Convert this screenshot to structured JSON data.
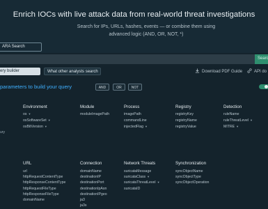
{
  "hero": {
    "title": "Enrich IOCs with live attack data from real-world threat investigations",
    "subtitle": "Search for IPs, URLs, hashes, events — or combine them using advanced logic (AND, OR, NOT, *)",
    "yara_button": "ARA Search"
  },
  "search": {
    "button": "Searc",
    "placeholder": ""
  },
  "tabs": [
    {
      "label": "ery builder",
      "active": true
    },
    {
      "label": "What other analysts search",
      "active": false
    }
  ],
  "links": {
    "pdf_guide": "Download PDF Guide",
    "api": "API do"
  },
  "prompt": "parameters to build your query",
  "operators": [
    "AND",
    "OR",
    "NOT"
  ],
  "toggle_state": "on",
  "stray_text": "ury",
  "columns_top": [
    {
      "header": "Environment",
      "items": [
        {
          "label": "os",
          "dropdown": true
        },
        {
          "label": "osSoftwareSet",
          "dropdown": true
        },
        {
          "label": "osBitVersion",
          "dropdown": true
        }
      ]
    },
    {
      "header": "Module",
      "items": [
        {
          "label": "moduleImagePath",
          "dropdown": false
        }
      ]
    },
    {
      "header": "Process",
      "items": [
        {
          "label": "imagePath",
          "dropdown": false
        },
        {
          "label": "commandLine",
          "dropdown": false
        },
        {
          "label": "injectedFlag",
          "dropdown": true
        }
      ]
    },
    {
      "header": "Registry",
      "items": [
        {
          "label": "registryKey",
          "dropdown": false
        },
        {
          "label": "registryName",
          "dropdown": false
        },
        {
          "label": "registryValue",
          "dropdown": false
        }
      ]
    },
    {
      "header": "Detection",
      "items": [
        {
          "label": "ruleName",
          "dropdown": false
        },
        {
          "label": "ruleThreatLevel",
          "dropdown": true
        },
        {
          "label": "MITRE",
          "dropdown": true
        }
      ]
    }
  ],
  "columns_bottom": [
    {
      "header": "URL",
      "items": [
        {
          "label": "url",
          "dropdown": false
        },
        {
          "label": "httpRequestContentType",
          "dropdown": false
        },
        {
          "label": "httpResponseContentType",
          "dropdown": false
        },
        {
          "label": "httpRequestFileType",
          "dropdown": false
        },
        {
          "label": "httpResponseFileType",
          "dropdown": false
        },
        {
          "label": "domainName",
          "dropdown": false
        }
      ]
    },
    {
      "header": "Connection",
      "items": [
        {
          "label": "domainName",
          "dropdown": false
        },
        {
          "label": "destinationIP",
          "dropdown": false
        },
        {
          "label": "destinationPort",
          "dropdown": false
        },
        {
          "label": "destinationIpAsn",
          "dropdown": false
        },
        {
          "label": "destinationIPgeo",
          "dropdown": false
        },
        {
          "label": "ja3",
          "dropdown": false
        },
        {
          "label": "ja3s",
          "dropdown": false
        }
      ]
    },
    {
      "header": "Network Threats",
      "items": [
        {
          "label": "suricataMessage",
          "dropdown": false
        },
        {
          "label": "suricataClass",
          "dropdown": true
        },
        {
          "label": "suricataThreatLevel",
          "dropdown": true
        },
        {
          "label": "suricataID",
          "dropdown": false
        }
      ]
    },
    {
      "header": "Synchronization",
      "items": [
        {
          "label": "syncObjectName",
          "dropdown": false
        },
        {
          "label": "syncObjectType",
          "dropdown": false
        },
        {
          "label": "syncObjectOperation",
          "dropdown": false
        }
      ]
    }
  ]
}
